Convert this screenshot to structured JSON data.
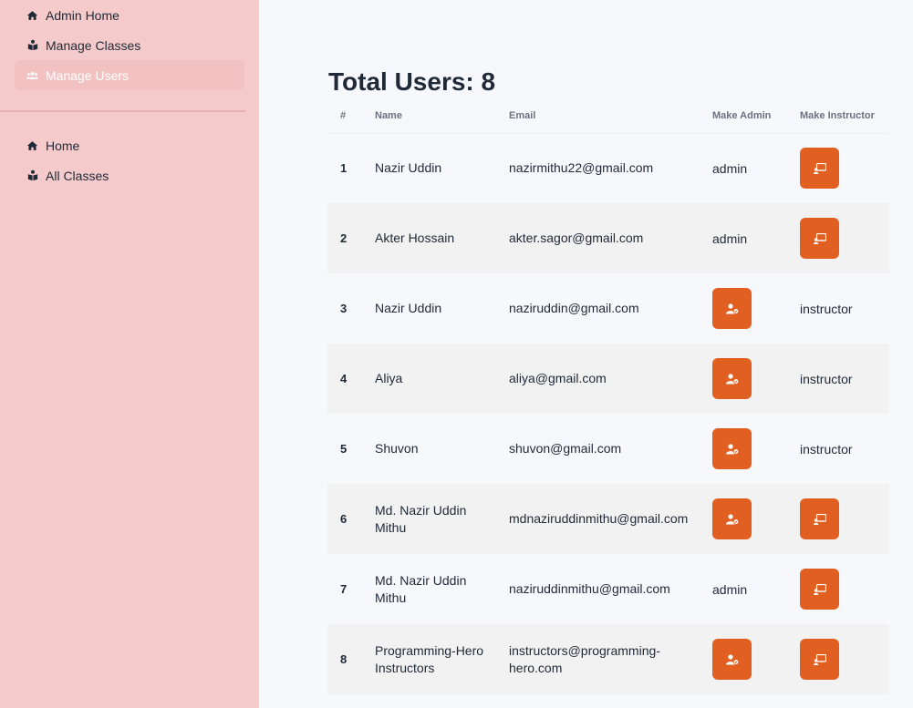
{
  "sidebar": {
    "top_items": [
      {
        "label": "Admin Home",
        "icon": "home-icon"
      },
      {
        "label": "Manage Classes",
        "icon": "book-reader-icon"
      },
      {
        "label": "Manage Users",
        "icon": "users-icon",
        "active": true
      }
    ],
    "bottom_items": [
      {
        "label": "Home",
        "icon": "home-icon"
      },
      {
        "label": "All Classes",
        "icon": "book-reader-icon"
      }
    ]
  },
  "main": {
    "title": "Total Users: 8",
    "columns": [
      "#",
      "Name",
      "Email",
      "Make Admin",
      "Make Instructor"
    ],
    "rows": [
      {
        "num": "1",
        "name": "Nazir Uddin",
        "email": "nazirmithu22@gmail.com",
        "admin": "admin",
        "instructor": null
      },
      {
        "num": "2",
        "name": "Akter Hossain",
        "email": "akter.sagor@gmail.com",
        "admin": "admin",
        "instructor": null
      },
      {
        "num": "3",
        "name": "Nazir Uddin",
        "email": "naziruddin@gmail.com",
        "admin": null,
        "instructor": "instructor"
      },
      {
        "num": "4",
        "name": "Aliya",
        "email": "aliya@gmail.com",
        "admin": null,
        "instructor": "instructor"
      },
      {
        "num": "5",
        "name": "Shuvon",
        "email": "shuvon@gmail.com",
        "admin": null,
        "instructor": "instructor"
      },
      {
        "num": "6",
        "name": "Md. Nazir Uddin Mithu",
        "email": "mdnaziruddinmithu@gmail.com",
        "admin": null,
        "instructor": null
      },
      {
        "num": "7",
        "name": "Md. Nazir Uddin Mithu",
        "email": "naziruddinmithu@gmail.com",
        "admin": "admin",
        "instructor": null
      },
      {
        "num": "8",
        "name": "Programming-Hero Instructors",
        "email": "instructors@programming-hero.com",
        "admin": null,
        "instructor": null
      }
    ]
  },
  "colors": {
    "sidebar_bg": "#f5caca",
    "active_item_bg": "#f2c2c2",
    "action_button": "#e25f22",
    "page_bg": "#f7f8fc"
  }
}
